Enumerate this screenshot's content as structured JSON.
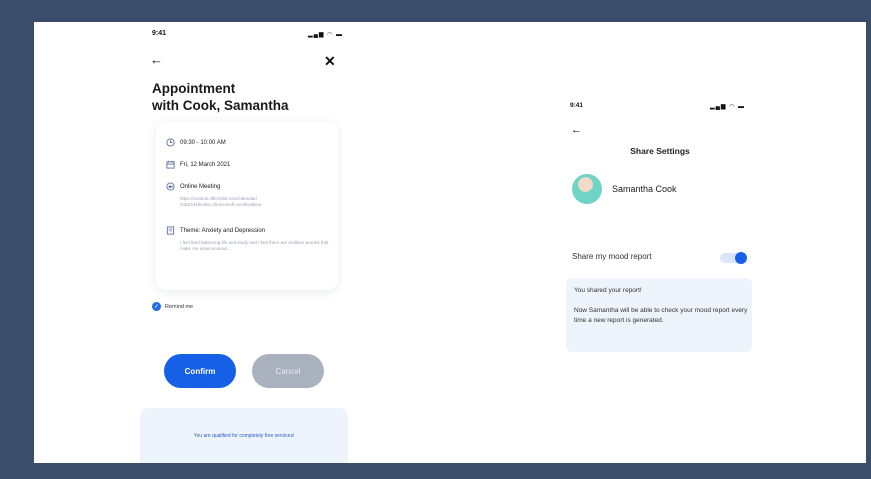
{
  "left_screen": {
    "status_time": "9:41",
    "status_icons": "▂▄▆ ◠ ▬",
    "back_icon": "←",
    "close_icon": "✕",
    "title_line1": "Appointment",
    "title_line2": "with Cook, Samantha",
    "time": "09:30 - 10:00 AM",
    "date": "Fri, 12 March 2021",
    "meeting_label": "Online Meeting",
    "meeting_link": "https://outlook.office365.com/calendar/ 245a7d4feed5c.2/microsoft.com/livekleur",
    "theme_label": "Theme: Anxiety and Depression",
    "theme_desc": "I feel tired balancing life and study and I feel there are endless worries that make me upset anxious...",
    "remind_label": "Remind me",
    "confirm_label": "Confirm",
    "cancel_label": "Cancel",
    "qualify_text": "You are qualified for completely free services!"
  },
  "right_screen": {
    "status_time": "9:41",
    "status_icons": "▂▄▆ ◠ ▬",
    "back_icon": "←",
    "title": "Share Settings",
    "contact_name": "Samantha Cook",
    "share_label": "Share my mood report",
    "toggle_on": true,
    "notice_title": "You shared your report!",
    "notice_body": "Now Samantha will be able to check your mood report every time a new report is generated."
  },
  "colors": {
    "background": "#3b4d6b",
    "accent": "#1560e6",
    "cancel": "#aab2bf",
    "panel": "#eef4fc"
  }
}
